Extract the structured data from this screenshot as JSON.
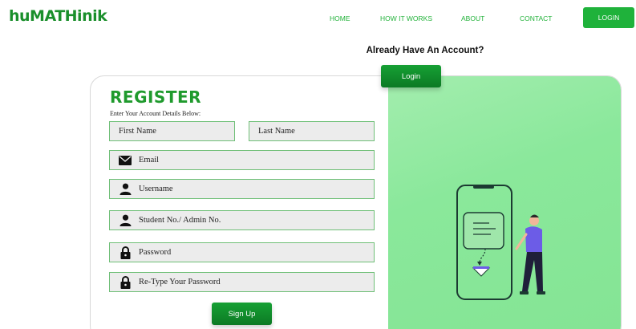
{
  "nav": {
    "logo": "huMATHinik",
    "links": [
      "HOME",
      "HOW IT WORKS",
      "ABOUT",
      "CONTACT"
    ],
    "login": "LOGIN"
  },
  "register": {
    "title": "REGISTER",
    "subtitle": "Enter Your Account Details Below:",
    "fields": {
      "first_name": "First Name",
      "last_name": "Last Name",
      "email": "Email",
      "username": "Username",
      "student_no": "Student No./ Admin No.",
      "password": "Password",
      "retype_password": "Re-Type Your Password"
    },
    "signup": "Sign Up"
  },
  "side": {
    "heading": "Already Have An Account?",
    "login": "Login"
  },
  "colors": {
    "brand_green": "#1fb23b",
    "panel_green": "#8ae89b",
    "field_border": "#6fbf77"
  }
}
